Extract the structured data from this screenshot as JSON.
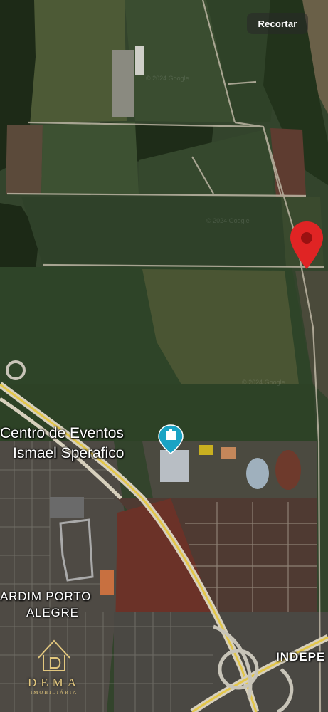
{
  "toolbar": {
    "crop_label": "Recortar"
  },
  "map": {
    "poi": {
      "name_line1": "Centro de Eventos",
      "name_line2": "Ismael Sperafico",
      "icon": "building-pin-icon",
      "color": "#1aa3c4"
    },
    "neighborhood": {
      "line1": "ARDIM PORTO",
      "line2": "ALEGRE"
    },
    "road": {
      "label": "INDEPE"
    },
    "marker": {
      "icon": "map-pin-icon",
      "color": "#e02424"
    },
    "imagery_credit": "© 2024 Google"
  },
  "watermark": {
    "logo": "house-d-logo",
    "brand": "DEMA",
    "tagline": "IMOBILIÁRIA",
    "color": "#e2c77e"
  }
}
